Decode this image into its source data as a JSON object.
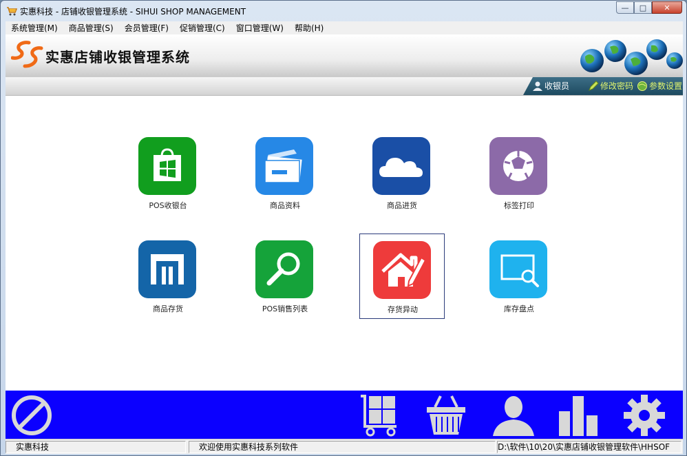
{
  "window": {
    "title": "实惠科技 - 店铺收银管理系统 - SIHUI SHOP MANAGEMENT",
    "buttons": {
      "minimize": "—",
      "maximize": "□",
      "close": "✕"
    }
  },
  "menu": [
    {
      "label": "系统管理(M)"
    },
    {
      "label": "商品管理(S)"
    },
    {
      "label": "会员管理(F)"
    },
    {
      "label": "促销管理(C)"
    },
    {
      "label": "窗口管理(W)"
    },
    {
      "label": "帮助(H)"
    }
  ],
  "header": {
    "title": "实惠店铺收银管理系统"
  },
  "toolbar": {
    "cashier_label": "收银员",
    "change_password_label": "修改密码",
    "settings_label": "参数设置"
  },
  "tiles": [
    {
      "label": "POS收银台",
      "color": "#119e1e",
      "icon": "store-bag-icon"
    },
    {
      "label": "商品资料",
      "color": "#2688e6",
      "icon": "documents-icon"
    },
    {
      "label": "商品进货",
      "color": "#1a4fa6",
      "icon": "cloud-icon"
    },
    {
      "label": "标签打印",
      "color": "#8c6aa8",
      "icon": "aperture-icon"
    },
    {
      "label": "商品存货",
      "color": "#1465a8",
      "icon": "warehouse-icon"
    },
    {
      "label": "POS销售列表",
      "color": "#15a33a",
      "icon": "magnifier-icon"
    },
    {
      "label": "存货异动",
      "color": "#ee3b3b",
      "icon": "house-pencil-icon",
      "selected": true
    },
    {
      "label": "库存盘点",
      "color": "#1fb2ee",
      "icon": "screen-search-icon"
    }
  ],
  "bottombar": {
    "color": "#0b00ff",
    "icons": [
      "exit-icon",
      "cart-icon",
      "basket-icon",
      "user-icon",
      "bar-chart-icon",
      "gear-icon"
    ]
  },
  "status": {
    "company": "实惠科技",
    "welcome": "欢迎使用实惠科技系列软件",
    "path": "D:\\软件\\10\\20\\实惠店铺收银管理软件\\HHSOF"
  }
}
